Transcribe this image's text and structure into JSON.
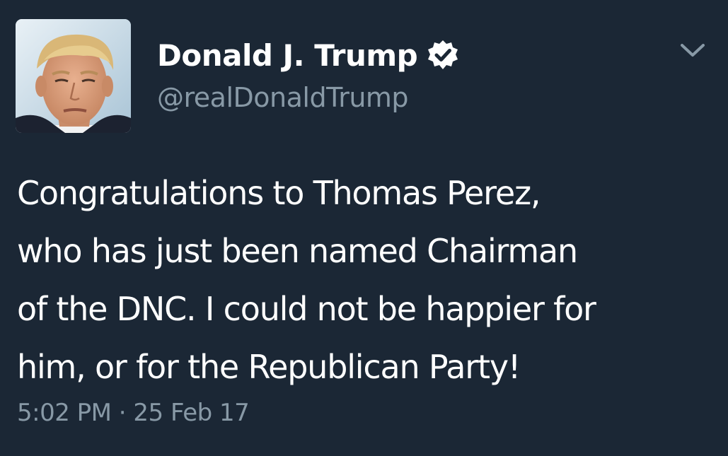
{
  "tweet": {
    "author": {
      "name": "Donald J. Trump",
      "handle": "@realDonaldTrump",
      "verified": true
    },
    "text_lines": [
      "Congratulations to Thomas Perez,",
      "who has just been named Chairman",
      "of the DNC. I could not be happier for",
      "him, or for the Republican Party!"
    ],
    "timestamp": "5:02 PM · 25 Feb 17"
  },
  "colors": {
    "background": "#1b2735",
    "primary_text": "#ffffff",
    "secondary_text": "#8899a6"
  },
  "icons": {
    "verified": "verified-badge-icon",
    "menu": "chevron-down-icon"
  }
}
